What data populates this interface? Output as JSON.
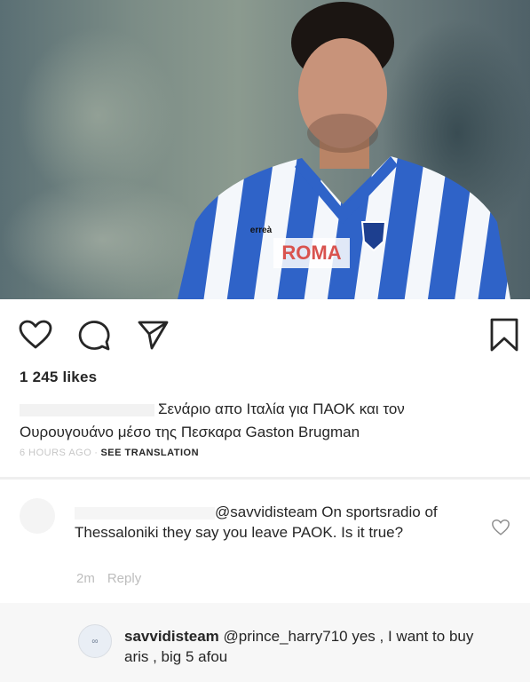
{
  "post": {
    "photo": {
      "shirt_sponsor": "ROMA",
      "kit_brand": "erreà"
    },
    "actions": {
      "like_icon": "heart-icon",
      "comment_icon": "comment-icon",
      "share_icon": "send-icon",
      "save_icon": "bookmark-icon"
    },
    "likes": "1 245 likes",
    "caption": "Σενάριο απο Ιταλία για ΠΑΟΚ και τον Ουρουγουάνο μέσο της Πεσκαρα Gaston Brugman",
    "time": "6 HOURS AGO",
    "separator": "·",
    "see_translation": "SEE TRANSLATION"
  },
  "comments": [
    {
      "mention": "@savvidisteam",
      "text": " On sportsradio of Thessaloniki they say you leave PAOK. Is it true?",
      "age": "2m",
      "reply_label": "Reply",
      "like_icon": "heart-icon"
    },
    {
      "avatar_label": "∞",
      "username": "savvidisteam",
      "text": " @prince_harry710 yes , I want to buy aris , big 5 afou"
    }
  ],
  "colors": {
    "shirt_blue": "#2f63c8",
    "text": "#262626",
    "muted": "#c7c7c7"
  }
}
